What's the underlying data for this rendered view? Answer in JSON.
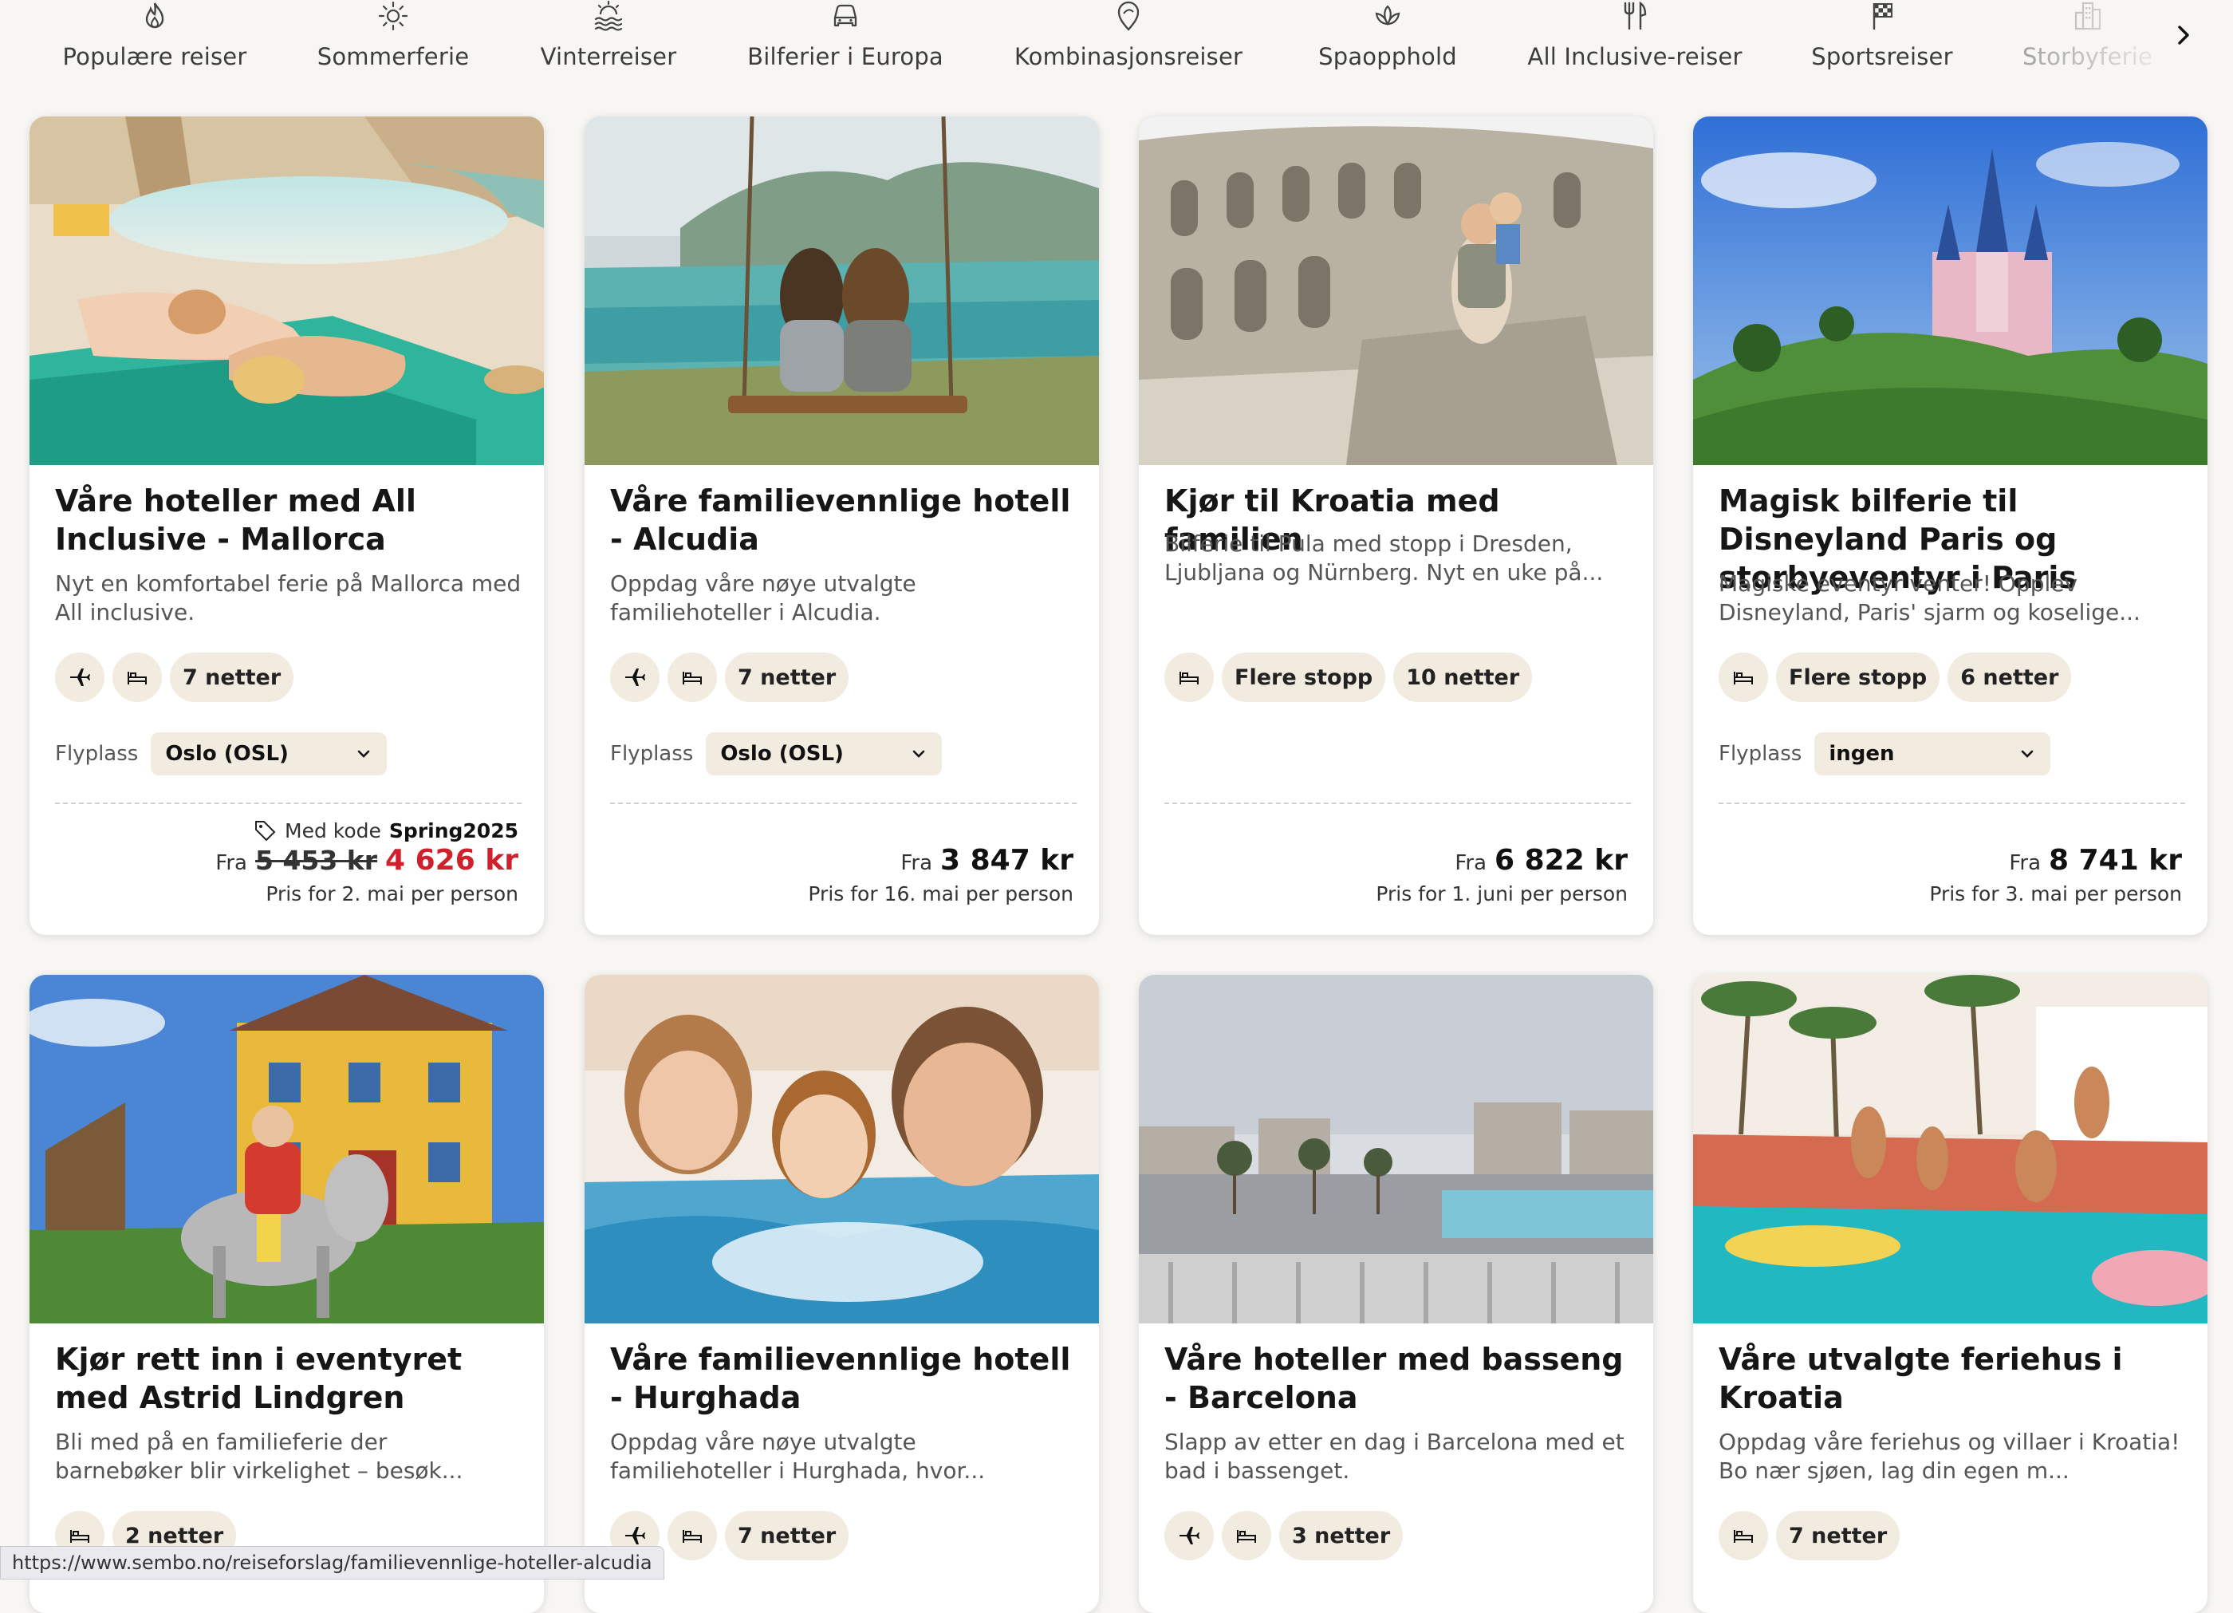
{
  "nav": {
    "categories": [
      {
        "label": "Populære reiser",
        "icon": "flame-icon"
      },
      {
        "label": "Sommerferie",
        "icon": "sun-icon"
      },
      {
        "label": "Vinterreiser",
        "icon": "snow-sun-icon"
      },
      {
        "label": "Bilferier i Europa",
        "icon": "car-icon"
      },
      {
        "label": "Kombinasjonsreiser",
        "icon": "route-icon"
      },
      {
        "label": "Spaopphold",
        "icon": "lotus-icon"
      },
      {
        "label": "All Inclusive-reiser",
        "icon": "cutlery-icon"
      },
      {
        "label": "Sportsreiser",
        "icon": "flag-icon"
      },
      {
        "label": "Storbyferie",
        "icon": "city-icon"
      }
    ],
    "next_icon": "chevron-right-icon"
  },
  "cards": [
    {
      "title": "Våre hoteller med All Inclusive - Mallorca",
      "description": "Nyt en komfortabel ferie på Mallorca med All inclusive.",
      "tags": [
        "7 netter"
      ],
      "airport_label": "Flyplass",
      "airport": "Oslo (OSL)",
      "promo_text": "Med kode",
      "promo_code": "Spring2025",
      "from": "Fra",
      "old_price": "5 453 kr",
      "price": "4 626 kr",
      "price_note": "Pris for 2. mai per person"
    },
    {
      "title": "Våre familievennlige hotell - Alcudia",
      "description": "Oppdag våre nøye utvalgte familiehoteller i Alcudia.",
      "tags": [
        "7 netter"
      ],
      "airport_label": "Flyplass",
      "airport": "Oslo (OSL)",
      "from": "Fra",
      "price": "3 847 kr",
      "price_note": "Pris for 16. mai per person"
    },
    {
      "title": "Kjør til Kroatia med familien",
      "description": "Bilferie til Pula med stopp i Dresden, Ljubljana og Nürnberg. Nyt en uke på...",
      "tags": [
        "Flere stopp",
        "10 netter"
      ],
      "from": "Fra",
      "price": "6 822 kr",
      "price_note": "Pris for 1. juni per person"
    },
    {
      "title": "Magisk bilferie til Disneyland Paris og storbyeventyr i Paris",
      "description": "Magiske eventyr venter! Opplev Disneyland, Paris' sjarm og koselige...",
      "tags": [
        "Flere stopp",
        "6 netter"
      ],
      "airport_label": "Flyplass",
      "airport": "ingen",
      "from": "Fra",
      "price": "8 741 kr",
      "price_note": "Pris for 3. mai per person"
    },
    {
      "title": "Kjør rett inn i eventyret med Astrid Lindgren",
      "description": "Bli med på en familieferie der barnebøker blir virkelighet – besøk...",
      "tags": [
        "2 netter"
      ]
    },
    {
      "title": "Våre familievennlige hotell - Hurghada",
      "description": "Oppdag våre nøye utvalgte familiehoteller i Hurghada, hvor...",
      "tags": [
        "7 netter"
      ]
    },
    {
      "title": "Våre hoteller med basseng - Barcelona",
      "description": "Slapp av etter en dag i Barcelona med et bad i bassenget.",
      "tags": [
        "3 netter"
      ]
    },
    {
      "title": "Våre utvalgte feriehus i Kroatia",
      "description": "Oppdag våre feriehus og villaer i Kroatia! Bo nær sjøen, lag din egen m...",
      "tags": [
        "7 netter"
      ]
    }
  ],
  "status_url": "https://www.sembo.no/reiseforslag/familievennlige-hoteller-alcudia",
  "colors": {
    "background": "#f7f6f3",
    "chip": "#f1ebe0",
    "sale_price": "#d0202b"
  }
}
